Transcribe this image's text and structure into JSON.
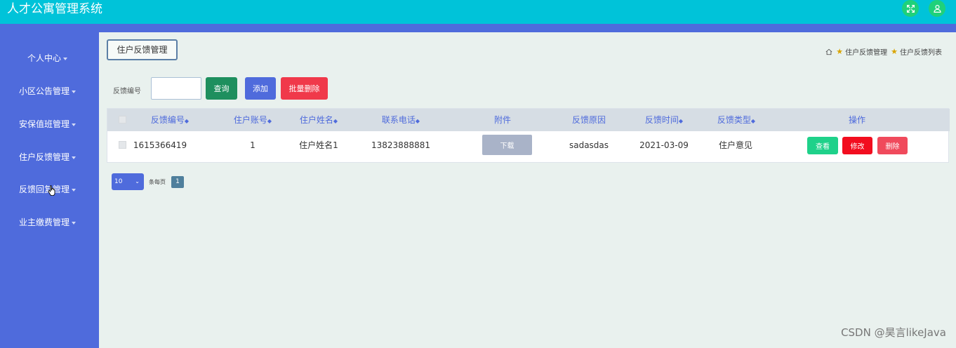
{
  "header": {
    "title": "人才公寓管理系统",
    "fullscreen_icon": "expand-icon",
    "user_icon": "user-icon",
    "accent_color": "#00c3d9"
  },
  "sidebar": {
    "items": [
      {
        "label": "个人中心"
      },
      {
        "label": "小区公告管理"
      },
      {
        "label": "安保值班管理"
      },
      {
        "label": "住户反馈管理"
      },
      {
        "label": "反馈回复管理"
      },
      {
        "label": "业主缴费管理"
      }
    ],
    "color": "#4f6bdc"
  },
  "page": {
    "tab_label": "住户反馈管理",
    "breadcrumb": [
      "住户反馈管理",
      "住户反馈列表"
    ]
  },
  "filter": {
    "label": "反馈编号",
    "value": "",
    "search_label": "查询",
    "add_label": "添加",
    "batch_delete_label": "批量删除"
  },
  "table": {
    "columns": [
      "反馈编号",
      "住户账号",
      "住户姓名",
      "联系电话",
      "附件",
      "反馈原因",
      "反馈时间",
      "反馈类型",
      "操作"
    ],
    "sort_mark": "◆",
    "rows": [
      {
        "feedback_no": "1615366419",
        "account": "1",
        "name": "住户姓名1",
        "phone": "13823888881",
        "attachment_label": "下载",
        "reason": "sadasdas",
        "time": "2021-03-09",
        "type": "住户意见",
        "actions": {
          "view": "查看",
          "edit": "修改",
          "delete": "删除"
        }
      }
    ]
  },
  "pagination": {
    "page_size": "10",
    "per_page_label": "条每页",
    "current_page": "1"
  },
  "watermark": "CSDN @昊言likeJava"
}
